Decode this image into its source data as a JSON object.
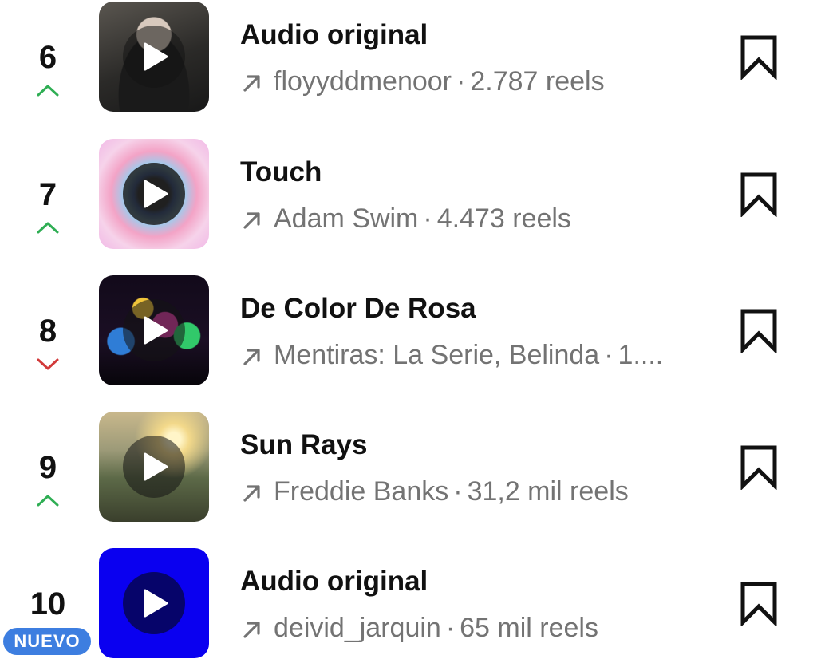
{
  "colors": {
    "trend_up": "#2fae54",
    "trend_down": "#d23a3a",
    "badge_bg": "#3d7ee0",
    "meta_text": "#737373"
  },
  "items": [
    {
      "rank": "6",
      "trend": "up",
      "title": "Audio original",
      "artist": "floyyddmenoor",
      "separator": "·",
      "reels": "2.787 reels",
      "thumbnail": "person-in-black-hoodie-photo"
    },
    {
      "rank": "7",
      "trend": "up",
      "title": "Touch",
      "artist": "Adam Swim",
      "separator": "·",
      "reels": "4.473 reels",
      "thumbnail": "pink-blue-gradient-art"
    },
    {
      "rank": "8",
      "trend": "down",
      "title": "De Color De Rosa",
      "artist": "Mentiras: La Serie, Belinda",
      "separator": "·",
      "reels": "1....",
      "thumbnail": "mentiras-series-poster"
    },
    {
      "rank": "9",
      "trend": "up",
      "title": "Sun Rays",
      "artist": "Freddie Banks",
      "separator": "·",
      "reels": "31,2 mil reels",
      "thumbnail": "sunset-landscape-photo"
    },
    {
      "rank": "10",
      "trend": "new",
      "badge": "NUEVO",
      "title": "Audio original",
      "artist": "deivid_jarquin",
      "separator": "·",
      "reels": "65 mil reels",
      "thumbnail": "solid-blue-square"
    }
  ]
}
